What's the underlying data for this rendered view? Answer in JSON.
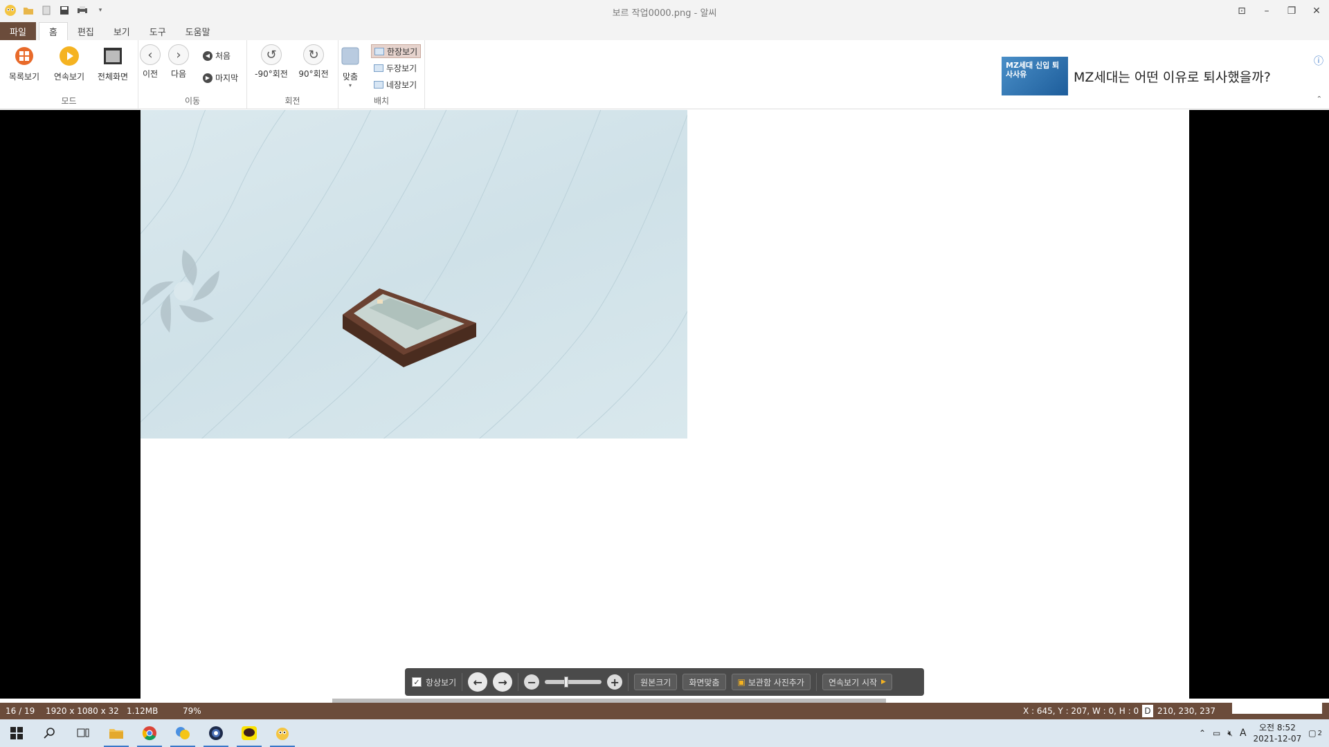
{
  "window": {
    "title": "보르 작업0000.png - 알씨"
  },
  "ribbon_tabs": [
    "파일",
    "홈",
    "편집",
    "보기",
    "도구",
    "도움말"
  ],
  "groups": {
    "mode": {
      "label": "모드",
      "list": "목록보기",
      "slideshow": "연속보기",
      "fullscreen": "전체화면"
    },
    "move": {
      "label": "이동",
      "prev": "이전",
      "next": "다음",
      "first": "처음",
      "last": "마지막"
    },
    "rotate": {
      "label": "회전",
      "ccw": "-90°회전",
      "cw": "90°회전"
    },
    "layout": {
      "label": "배치",
      "fit": "맞춤",
      "one": "한장보기",
      "two": "두장보기",
      "four": "네장보기"
    }
  },
  "ad": {
    "image_text": "MZ세대 신입 퇴사사유",
    "headline": "MZ세대는 어떤 이유로 퇴사했을까?"
  },
  "floatbar": {
    "always_show": "항상보기",
    "original_size": "원본크기",
    "fit_screen": "화면맞춤",
    "add_to_storage": "보관함 사진추가",
    "slideshow_start": "연속보기 시작"
  },
  "status": {
    "index": "16 / 19",
    "dims": "1920 x 1080 x 32",
    "size": "1.12MB",
    "zoom": "79%",
    "coords": "X : 645, Y : 207, W : 0, H : 0",
    "color_badge": "D",
    "color": "210, 230, 237"
  },
  "clock": {
    "time": "오전 8:52",
    "date": "2021-12-07"
  },
  "tray": {
    "ime": "A",
    "notif_count": "2"
  },
  "colors": {
    "brand_brown": "#6b4c3b",
    "accent_blue": "#3a78c8"
  }
}
